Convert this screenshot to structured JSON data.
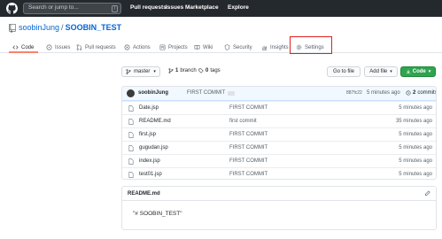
{
  "topbar": {
    "logo": "github-mark-icon",
    "search_placeholder": "Search or jump to...",
    "search_shortcut": "/",
    "nav": [
      "Pull requests",
      "Issues",
      "Marketplace",
      "Explore"
    ]
  },
  "repo": {
    "icon": "repo-icon",
    "owner": "soobinJung",
    "separator": "/",
    "name": "SOOBIN_TEST"
  },
  "tabs": [
    {
      "label": "Code",
      "icon": "code-icon"
    },
    {
      "label": "Issues",
      "icon": "issue-icon"
    },
    {
      "label": "Pull requests",
      "icon": "pull-request-icon"
    },
    {
      "label": "Actions",
      "icon": "actions-icon"
    },
    {
      "label": "Projects",
      "icon": "projects-icon"
    },
    {
      "label": "Wiki",
      "icon": "book-icon"
    },
    {
      "label": "Security",
      "icon": "shield-icon"
    },
    {
      "label": "Insights",
      "icon": "graph-icon"
    },
    {
      "label": "Settings",
      "icon": "gear-icon"
    }
  ],
  "branch_bar": {
    "branch": "master",
    "branch_count": "1",
    "branch_label": "branch",
    "tag_count": "0",
    "tag_label": "tags",
    "goto_file": "Go to file",
    "add_file": "Add file",
    "code": "Code"
  },
  "commit": {
    "user": "soobinJung",
    "message": "FIRST COMMIT",
    "hash": "887fc22",
    "time": "5 minutes ago",
    "count": "2",
    "count_label": "commits"
  },
  "files": [
    {
      "name": "Date.jsp",
      "message": "FIRST COMMIT",
      "time": "5 minutes ago"
    },
    {
      "name": "README.md",
      "message": "first commit",
      "time": "35 minutes ago"
    },
    {
      "name": "first.jsp",
      "message": "FIRST COMMIT",
      "time": "5 minutes ago"
    },
    {
      "name": "gugudan.jsp",
      "message": "FIRST COMMIT",
      "time": "5 minutes ago"
    },
    {
      "name": "index.jsp",
      "message": "FIRST COMMIT",
      "time": "5 minutes ago"
    },
    {
      "name": "test01.jsp",
      "message": "FIRST COMMIT",
      "time": "5 minutes ago"
    }
  ],
  "readme": {
    "title": "README.md",
    "content": "\"# SOOBIN_TEST\""
  },
  "colors": {
    "header_bg": "#24292e",
    "link": "#0366d6",
    "active_tab_underline": "#f9826c",
    "highlight_box": "#e0201f",
    "primary_button": "#2ea44f"
  }
}
